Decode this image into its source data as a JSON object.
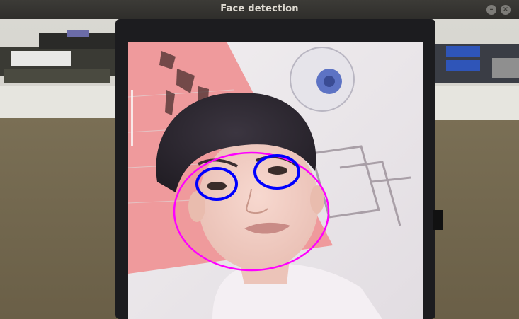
{
  "window": {
    "title": "Face detection",
    "minimize_glyph": "–",
    "close_glyph": "×"
  },
  "detections": {
    "face_color": "#ff00ff",
    "eye_color": "#0000ff",
    "face_count": 1,
    "eye_count": 2
  },
  "icons": {
    "minimize": "minimize-icon",
    "close": "close-icon"
  }
}
